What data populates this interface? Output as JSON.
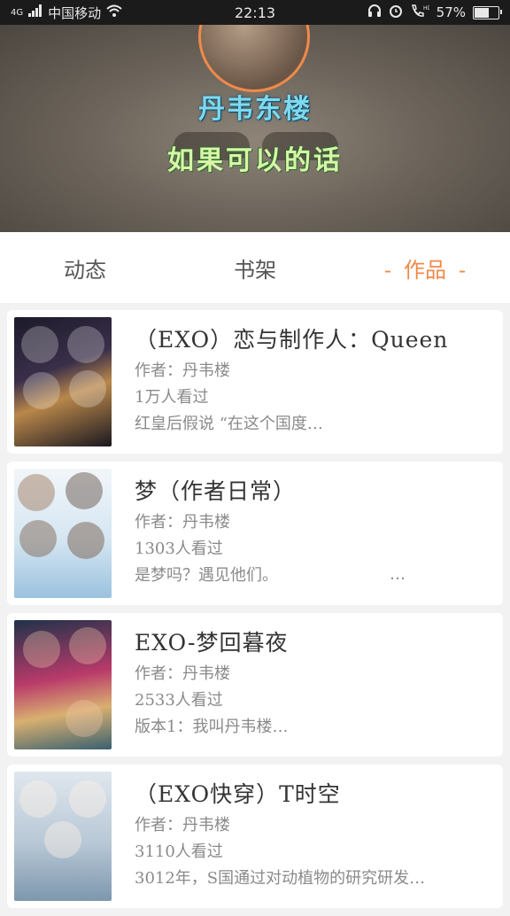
{
  "status_bar": {
    "network": "4G",
    "carrier": "中国移动",
    "time": "22:13",
    "battery": "57%",
    "icons": [
      "signal-icon",
      "wifi-icon",
      "headset-icon",
      "alarm-icon",
      "hd-call-icon",
      "battery-icon"
    ]
  },
  "profile": {
    "author_name": "丹韦东楼",
    "signature": "如果可以的话"
  },
  "tabs": [
    {
      "label": "动态"
    },
    {
      "label": "书架"
    },
    {
      "label": "作品",
      "active": true
    }
  ],
  "colors": {
    "accent": "#f08a4b"
  },
  "works": [
    {
      "title": "（EXO）恋与制作人：Queen",
      "author": "作者：丹韦楼",
      "views": "1万人看过",
      "excerpt": "红皇后假说 “在这个国度…"
    },
    {
      "title": "梦（作者日常）",
      "author": "作者：丹韦楼",
      "views": "1303人看过",
      "excerpt": "是梦吗？遇见他们。",
      "more": "…"
    },
    {
      "title": "EXO-梦回暮夜",
      "author": "作者：丹韦楼",
      "views": "2533人看过",
      "excerpt": "版本1：我叫丹韦楼…"
    },
    {
      "title": "（EXO快穿）T时空",
      "author": "作者：丹韦楼",
      "views": "3110人看过",
      "excerpt": "3012年，S国通过对动植物的研究研发…"
    }
  ]
}
